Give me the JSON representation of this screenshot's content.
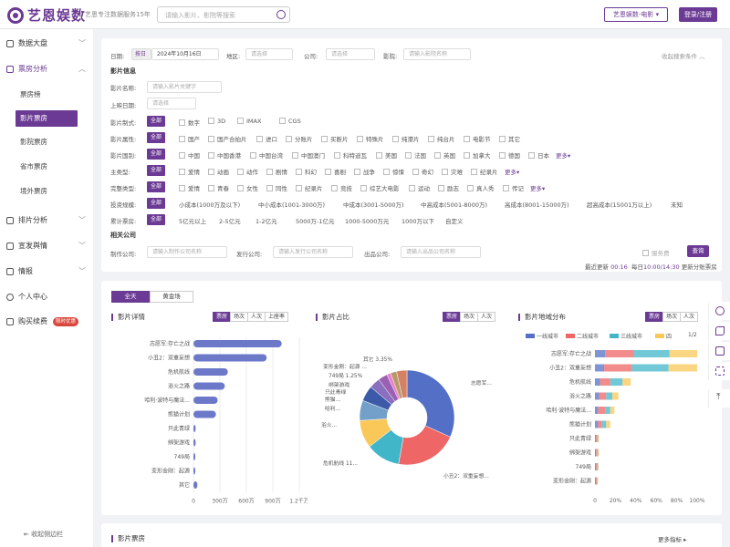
{
  "header": {
    "logo_text": "艺恩娱数",
    "slogan": "艺恩专注数据服务15年",
    "search_placeholder": "请输入影片、影院等搜索",
    "product": "艺恩娱数-电影 ▾",
    "login": "登录/注册"
  },
  "sidebar": {
    "items": [
      {
        "label": "数据大盘"
      },
      {
        "label": "票房分析"
      },
      {
        "label": "排片分析"
      },
      {
        "label": "宣发舆情"
      },
      {
        "label": "情报"
      },
      {
        "label": "个人中心"
      },
      {
        "label": "购买续费"
      }
    ],
    "sub": [
      "票房榜",
      "影片票房",
      "影院票房",
      "省市票房",
      "境外票房"
    ],
    "badge": "限时优惠",
    "collapse": "收起侧边栏"
  },
  "filters": {
    "date_label": "日期:",
    "date_mode": "按日",
    "date_value": "2024年10月16日",
    "region_label": "地区:",
    "region_ph": "请选择",
    "company_label": "公司:",
    "company_ph": "请选择",
    "cinema_label": "影院:",
    "cinema_ph": "请输入影院名称",
    "collapse_link": "收起搜索条件 ︿",
    "movie_info": "影片信息",
    "name_label": "影片名称:",
    "name_ph": "请输入影片关键字",
    "release_label": "上映日期:",
    "release_ph": "请选择",
    "format_label": "影片制式:",
    "formats": [
      "数字",
      "3D",
      "IMAX",
      "CGS"
    ],
    "attr_label": "影片属性:",
    "attrs": [
      "国产",
      "国产合拍片",
      "进口",
      "分账片",
      "买断片",
      "特殊片",
      "纯港片",
      "纯台片",
      "电影节",
      "其它"
    ],
    "country_label": "影片国别:",
    "countries": [
      "中国",
      "中国香港",
      "中国台湾",
      "中国澳门",
      "科特迪瓦",
      "美国",
      "法国",
      "英国",
      "加拿大",
      "德国",
      "日本"
    ],
    "main_label": "主类型:",
    "mains": [
      "爱情",
      "动画",
      "动作",
      "剧情",
      "科幻",
      "喜剧",
      "战争",
      "惊悚",
      "奇幻",
      "灾难",
      "纪录片"
    ],
    "full_label": "完整类型:",
    "fulls": [
      "爱情",
      "青春",
      "女性",
      "同性",
      "纪录片",
      "竞技",
      "综艺大电影",
      "运动",
      "励志",
      "真人秀",
      "传记"
    ],
    "invest_label": "投资规模:",
    "invests": [
      "小成本(1000万及以下)",
      "中小成本(1001-3000万)",
      "中成本(3001-5000万)",
      "中高成本(5001-8000万)",
      "高成本(8001-15000万)",
      "超高成本(15001万以上)",
      "未知"
    ],
    "cum_label": "累计票房:",
    "cums": [
      "5亿元以上",
      "2-5亿元",
      "1-2亿元",
      "5000万-1亿元",
      "1000-5000万元",
      "1000万以下",
      "自定义"
    ],
    "related": "相关公司",
    "prod_label": "制作公司:",
    "prod_ph": "请输入制作公司名称",
    "dist_label": "发行公司:",
    "dist_ph": "请输入发行公司名称",
    "prodf_label": "出品公司:",
    "prodf_ph": "请输入出品公司名称",
    "svc": "服务费",
    "query": "查询",
    "all": "全部",
    "more": "更多▾",
    "update_label": "最近更新",
    "update_time": "00:16",
    "daily": "每日",
    "daily_time": "10:00/14:30",
    "daily_suffix": "更新分账票房"
  },
  "tabs": {
    "t1": "全天",
    "t2": "黄金场"
  },
  "panels": [
    {
      "title": "影片详情",
      "seg": [
        "票房",
        "场次",
        "人次",
        "上座率"
      ]
    },
    {
      "title": "影片占比",
      "seg": [
        "票房",
        "场次",
        "人次"
      ]
    },
    {
      "title": "影片地域分布",
      "seg": [
        "票房",
        "场次",
        "人次"
      ]
    }
  ],
  "legend": [
    "一线城市",
    "二线城市",
    "三线城市",
    "四",
    "1/2"
  ],
  "bottom": {
    "title": "影片票房",
    "more": "更多指标 ▸"
  },
  "colors": {
    "accent": "#6b3a94",
    "pie": [
      "#5470c6",
      "#ee6666",
      "#42b6c9",
      "#fac858",
      "#73a0c9",
      "#3c5aa8",
      "#8a6fbf",
      "#9a60b4",
      "#ea7ccc",
      "#b89a6a",
      "#d48265"
    ]
  },
  "chart_data": [
    {
      "type": "bar",
      "title": "影片详情",
      "categories": [
        "志愿军:存亡之战",
        "小丑2：双重妄想",
        "危机航线",
        "浴火之路",
        "哈利·波特与魔法...",
        "熊猫计划",
        "只此青绿",
        "绑架游戏",
        "749局",
        "变形金刚：起源",
        "其它"
      ],
      "values": [
        1000,
        830,
        390,
        355,
        275,
        255,
        25,
        25,
        20,
        18,
        45
      ],
      "xticks": [
        "0",
        "300万",
        "600万",
        "900万",
        "1.2千万"
      ],
      "xlim": [
        0,
        1200
      ]
    },
    {
      "type": "pie",
      "title": "影片占比",
      "labels": [
        "志愿军...",
        "小丑2：双重妄想...",
        "危机航线 11...",
        "浴火...",
        "熊猫...",
        "哈利...",
        "只此青绿",
        "绑架游戏",
        "749局 1.25%",
        "变形金刚：起源 ...",
        "其它 3.35%"
      ],
      "values": [
        30,
        20,
        11,
        9,
        6.5,
        5,
        3.5,
        3,
        1.25,
        2,
        3.35
      ]
    },
    {
      "type": "bar",
      "title": "影片地域分布",
      "categories": [
        "志愿军:存亡之战",
        "小丑2：双重妄想",
        "危机航线",
        "浴火之路",
        "哈利·波特与魔法...",
        "熊猫计划",
        "只此青绿",
        "绑架游戏",
        "749局",
        "变形金刚：起源"
      ],
      "stacked": [
        [
          10,
          28,
          35,
          27
        ],
        [
          9,
          27,
          36,
          28
        ],
        [
          5,
          10,
          12,
          8
        ],
        [
          4,
          7,
          6,
          6
        ],
        [
          3,
          7,
          5,
          4
        ],
        [
          3,
          4,
          4,
          4
        ],
        [
          1,
          1,
          1,
          1
        ],
        [
          1,
          1,
          1,
          1
        ],
        [
          1,
          1,
          1,
          0.5
        ],
        [
          1,
          1,
          0.5,
          0.5
        ]
      ],
      "xticks": [
        "0",
        "20%",
        "40%",
        "60%",
        "80%",
        "100%"
      ]
    }
  ]
}
